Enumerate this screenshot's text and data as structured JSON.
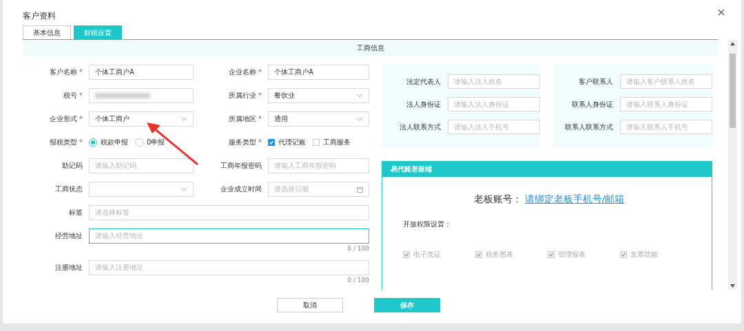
{
  "window": {
    "title": "客户资料"
  },
  "tabs": [
    {
      "label": "基本信息",
      "selected": false
    },
    {
      "label": "财税设置",
      "selected": true
    }
  ],
  "section_title": "工商信息",
  "fields": [
    {
      "label": "客户名称",
      "required_mark": "*",
      "kind": "input",
      "value": "个体工商户A"
    },
    {
      "label": "企业名称",
      "required_mark": "*",
      "kind": "input",
      "value": "个体工商户A"
    },
    {
      "label": "税号",
      "required_mark": "*",
      "kind": "blurred"
    },
    {
      "label": "所属行业",
      "required_mark": "*",
      "kind": "select",
      "value": "餐饮业"
    },
    {
      "label": "企业形式",
      "required_mark": "*",
      "kind": "select",
      "value": "个体工商户"
    },
    {
      "label": "所属地区",
      "required_mark": "*",
      "kind": "select",
      "value": "通用"
    },
    {
      "label": "报税类型",
      "required_mark": "*",
      "kind": "radios",
      "options": [
        {
          "label": "税款申报",
          "selected": true
        },
        {
          "label": "0申报",
          "selected": false
        }
      ]
    },
    {
      "label": "服务类型",
      "required_mark": "*",
      "kind": "checks",
      "options": [
        {
          "label": "代理记账",
          "checked": true
        },
        {
          "label": "工商服务",
          "checked": false
        }
      ]
    },
    {
      "label": "助记码",
      "kind": "input",
      "placeholder": "请输入助记码"
    },
    {
      "label": "工商年报密码",
      "kind": "input",
      "placeholder": "请输入工商年报密码"
    },
    {
      "label": "工商状态",
      "kind": "select"
    },
    {
      "label": "企业成立时间",
      "kind": "date",
      "placeholder": "请选择日期"
    },
    {
      "label": "标签",
      "kind": "wide",
      "placeholder": "请选择标签"
    },
    {
      "label": "经营地址",
      "kind": "wide",
      "placeholder": "请输入经营地址",
      "focused": true,
      "counter": "0 / 100"
    },
    {
      "label": "注册地址",
      "kind": "wide",
      "placeholder": "请输入注册地址",
      "focused": false,
      "counter": "0 / 100"
    }
  ],
  "contact_panels": [
    {
      "fields": [
        {
          "label": "法定代表人",
          "placeholder": "请输入法人姓名"
        },
        {
          "label": "法人身份证",
          "placeholder": "请输入法人身份证"
        },
        {
          "label": "法人联系方式",
          "placeholder": "请输入法人手机号"
        }
      ]
    },
    {
      "fields": [
        {
          "label": "客户联系人",
          "placeholder": "请输入客户联系人姓名"
        },
        {
          "label": "联系人身份证",
          "placeholder": "请输入联系人身份证"
        },
        {
          "label": "联系人联系方式",
          "placeholder": "请输入联系人手机号"
        }
      ]
    }
  ],
  "boss_panel": {
    "title": "易代账老板端",
    "account_label": "老板账号：",
    "account_link": "请绑定老板手机号/邮箱",
    "permissions_label": "开放权限设置：",
    "permissions": [
      {
        "label": "电子凭证",
        "checked": true
      },
      {
        "label": "税务图表",
        "checked": true
      },
      {
        "label": "管理报表",
        "checked": true
      },
      {
        "label": "发票功能",
        "checked": true
      }
    ]
  },
  "buttons": [
    {
      "label": "取消",
      "kind": "default"
    },
    {
      "label": "保存",
      "kind": "primary"
    }
  ]
}
